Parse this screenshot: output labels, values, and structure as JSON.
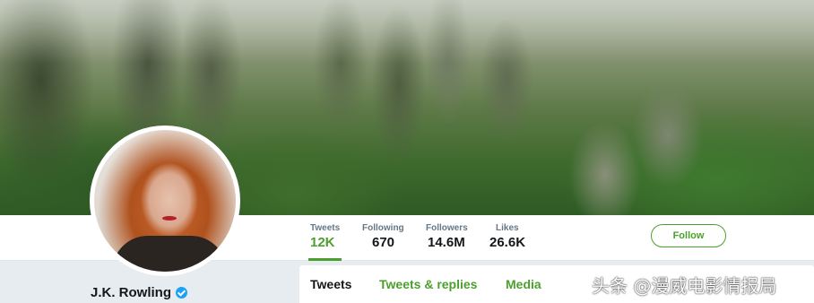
{
  "profile": {
    "name": "J.K. Rowling"
  },
  "stats": [
    {
      "label": "Tweets",
      "value": "12K",
      "active": true
    },
    {
      "label": "Following",
      "value": "670"
    },
    {
      "label": "Followers",
      "value": "14.6M"
    },
    {
      "label": "Likes",
      "value": "26.6K"
    }
  ],
  "follow_label": "Follow",
  "tabs": [
    {
      "label": "Tweets",
      "active": true
    },
    {
      "label": "Tweets & replies"
    },
    {
      "label": "Media"
    }
  ],
  "watermark": "头条 @漫威电影情报局",
  "colors": {
    "accent": "#4aa02c",
    "verified": "#1da1f2"
  },
  "icons": [
    "verified-icon"
  ]
}
